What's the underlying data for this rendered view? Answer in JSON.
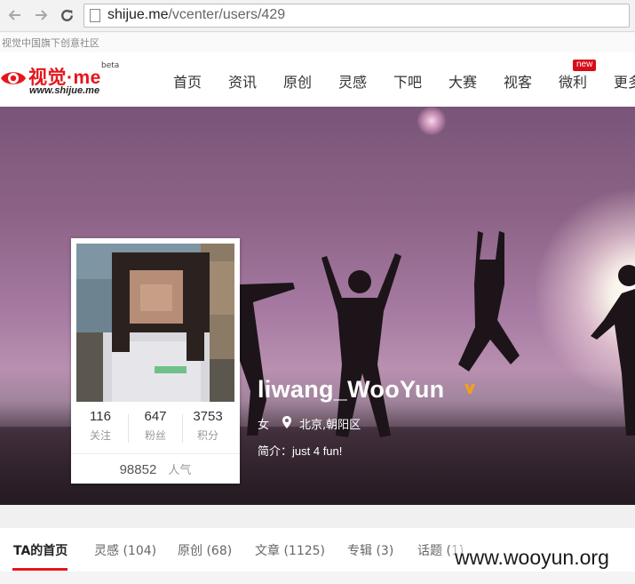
{
  "browser": {
    "url_host": "shijue.me",
    "url_path": "/vcenter/users/429",
    "tab_title": "视觉中国旗下创意社区"
  },
  "site": {
    "logo_text": "视觉·me",
    "logo_sub": "www.shijue.me",
    "logo_beta": "beta",
    "accent_color": "#e4161b",
    "nav": [
      {
        "label": "首页"
      },
      {
        "label": "资讯"
      },
      {
        "label": "原创"
      },
      {
        "label": "灵感"
      },
      {
        "label": "下吧"
      },
      {
        "label": "大赛"
      },
      {
        "label": "视客"
      },
      {
        "label": "微利",
        "badge": "new"
      },
      {
        "label": "更多"
      }
    ]
  },
  "profile": {
    "username": "liwang_WooYun",
    "gender": "女",
    "location": "北京,朝阳区",
    "bio_label": "简介：",
    "bio": "just 4 fun!",
    "stats": [
      {
        "value": "116",
        "label": "关注"
      },
      {
        "value": "647",
        "label": "粉丝"
      },
      {
        "value": "3753",
        "label": "积分"
      }
    ],
    "popularity_value": "98852",
    "popularity_label": "人气"
  },
  "tabs": [
    {
      "label": "TA的首页",
      "active": true
    },
    {
      "label": "灵感 (104)"
    },
    {
      "label": "原创 (68)"
    },
    {
      "label": "文章 (1125)"
    },
    {
      "label": "专辑 (3)"
    },
    {
      "label": "话题 (1)"
    }
  ],
  "watermark": "www.wooyun.org"
}
